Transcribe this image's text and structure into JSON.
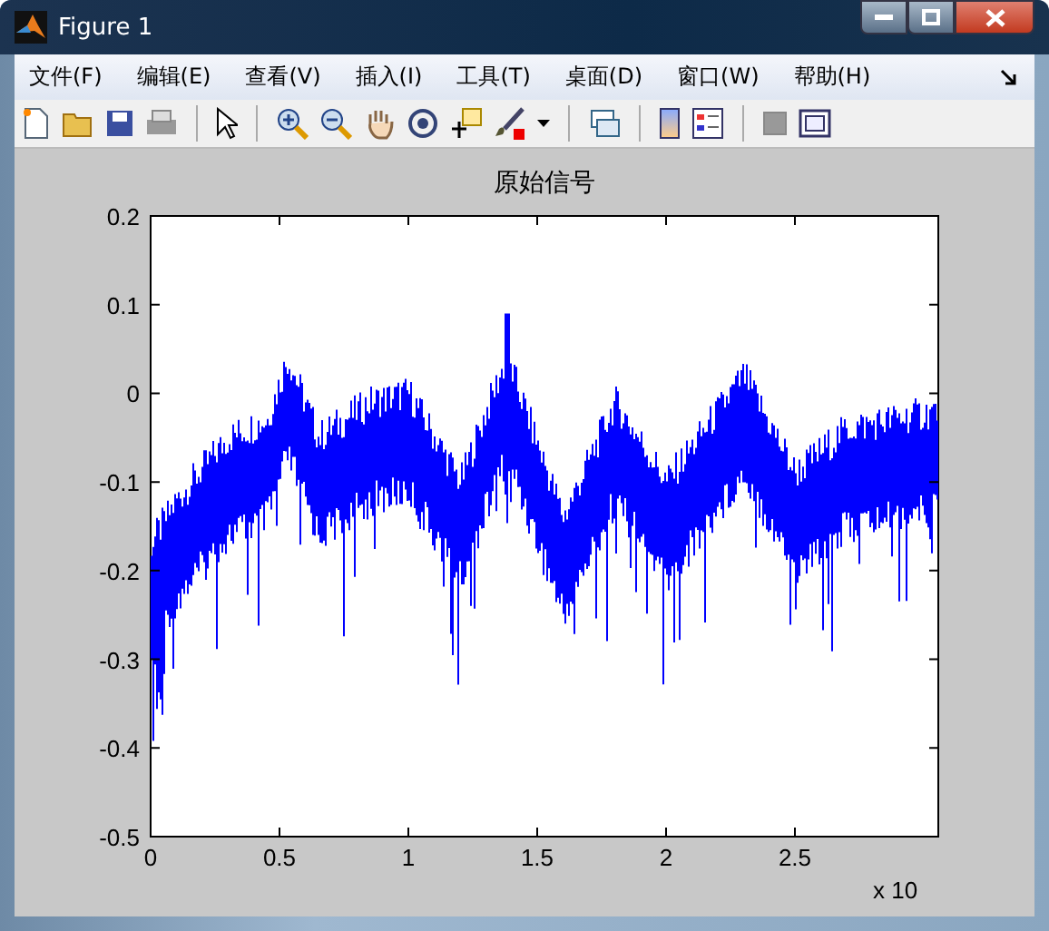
{
  "window": {
    "title": "Figure 1"
  },
  "menu": [
    "文件(F)",
    "编辑(E)",
    "查看(V)",
    "插入(I)",
    "工具(T)",
    "桌面(D)",
    "窗口(W)",
    "帮助(H)"
  ],
  "plot": {
    "title": "原始信号",
    "yticks": [
      "0.2",
      "0.1",
      "0",
      "-0.1",
      "-0.2",
      "-0.3",
      "-0.4",
      "-0.5"
    ],
    "xticks": [
      "0",
      "0.5",
      "1",
      "1.5",
      "2",
      "2.5"
    ],
    "x_exponent": "x 10"
  }
}
